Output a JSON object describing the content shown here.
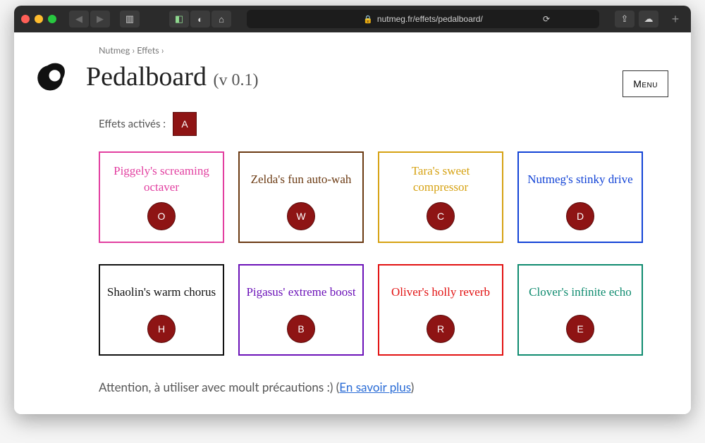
{
  "browser": {
    "url_display": "nutmeg.fr/effets/pedalboard/"
  },
  "breadcrumb": {
    "items": [
      "Nutmeg",
      "Effets"
    ],
    "sep": " › "
  },
  "header": {
    "title": "Pedalboard",
    "version": "(v 0.1)",
    "menu_label": "Menu"
  },
  "active": {
    "label": "Effets activés :",
    "items": [
      "A"
    ]
  },
  "pedals": [
    {
      "name": "Piggely's screaming octaver",
      "key": "O",
      "color": "#e23fa0"
    },
    {
      "name": "Zelda's fun auto-wah",
      "key": "W",
      "color": "#6b3a12"
    },
    {
      "name": "Tara's sweet compressor",
      "key": "C",
      "color": "#d6a213"
    },
    {
      "name": "Nutmeg's stinky drive",
      "key": "D",
      "color": "#1243d6"
    },
    {
      "name": "Shaolin's warm chorus",
      "key": "H",
      "color": "#111111"
    },
    {
      "name": "Pigasus' extreme boost",
      "key": "B",
      "color": "#6b12b8"
    },
    {
      "name": "Oliver's holly reverb",
      "key": "R",
      "color": "#e21212"
    },
    {
      "name": "Clover's infinite echo",
      "key": "E",
      "color": "#0f8b6f"
    }
  ],
  "warning": {
    "text_before": "Attention, à utiliser avec moult précautions :) (",
    "link_text": "En savoir plus",
    "text_after": ")"
  }
}
